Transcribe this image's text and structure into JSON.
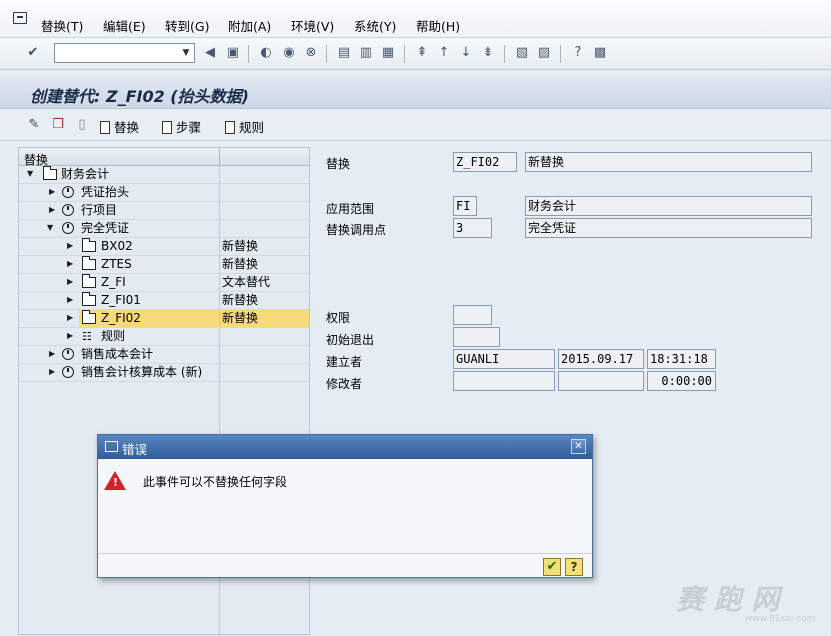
{
  "menu": [
    "替换(T)",
    "编辑(E)",
    "转到(G)",
    "附加(A)",
    "环境(V)",
    "系统(Y)",
    "帮助(H)"
  ],
  "toolbar": {
    "command_field_value": ""
  },
  "title": "创建替代: Z_FI02 (抬头数据)",
  "app_toolbar": {
    "replace_label": "替换",
    "step_label": "步骤",
    "rule_label": "规则"
  },
  "tree": {
    "header": "替换",
    "rows": [
      {
        "label": "财务会计",
        "desc": ""
      },
      {
        "label": "凭证抬头",
        "desc": ""
      },
      {
        "label": "行项目",
        "desc": ""
      },
      {
        "label": "完全凭证",
        "desc": ""
      },
      {
        "label": "BX02",
        "desc": "新替换"
      },
      {
        "label": "ZTES",
        "desc": "新替换"
      },
      {
        "label": "Z_FI",
        "desc": "文本替代"
      },
      {
        "label": "Z_FI01",
        "desc": "新替换"
      },
      {
        "label": "Z_FI02",
        "desc": "新替换"
      },
      {
        "label": "规则",
        "desc": ""
      },
      {
        "label": "销售成本会计",
        "desc": ""
      },
      {
        "label": "销售会计核算成本 (新)",
        "desc": ""
      }
    ]
  },
  "form": {
    "substitution_label": "替换",
    "substitution_value": "Z_FI02",
    "substitution_desc": "新替换",
    "app_area_label": "应用范围",
    "app_area_value": "FI",
    "app_area_desc": "财务会计",
    "call_point_label": "替换调用点",
    "call_point_value": "3",
    "call_point_desc": "完全凭证",
    "auth_label": "权限",
    "auth_value": "",
    "initial_exit_label": "初始退出",
    "initial_exit_value": "",
    "created_by_label": "建立者",
    "created_by": "GUANLI",
    "created_date": "2015.09.17",
    "created_time": "18:31:18",
    "changed_by_label": "修改者",
    "changed_by": "",
    "changed_date": "",
    "changed_time": "0:00:00"
  },
  "dialog": {
    "title": "错误",
    "message": "此事件可以不替换任何字段"
  },
  "watermark": {
    "text": "赛 跑 网",
    "url": "www.91sai.com"
  }
}
